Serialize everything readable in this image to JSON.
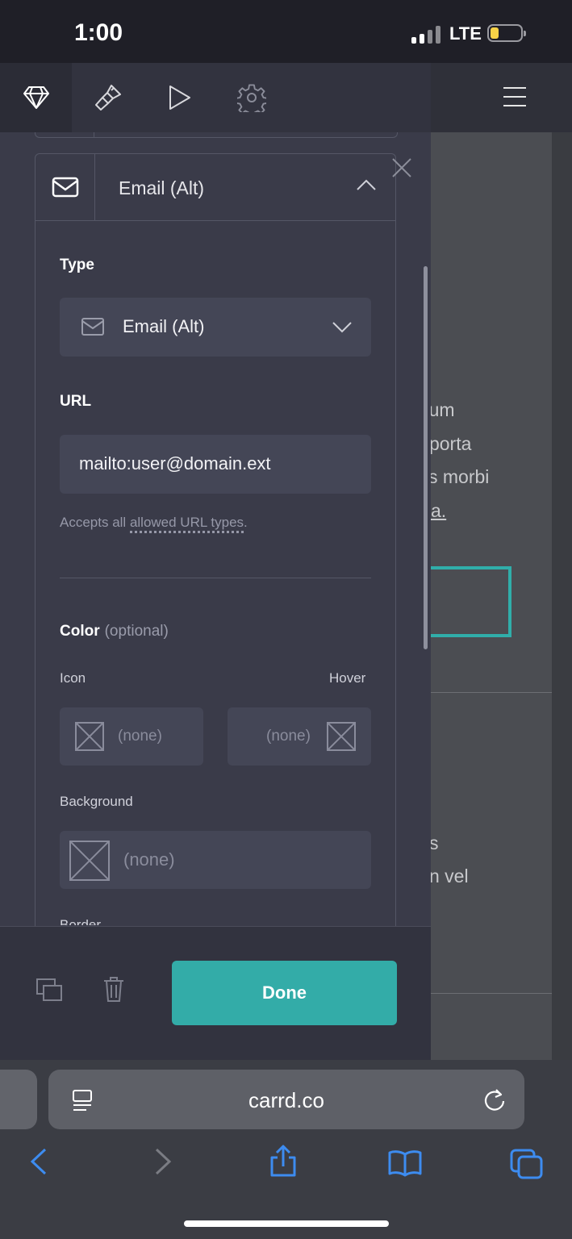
{
  "status_bar": {
    "time": "1:00",
    "network": "LTE"
  },
  "background_site": {
    "lines": [
      "terdum",
      "eu porta",
      "s morbi",
      "a.",
      "s",
      "n vel"
    ]
  },
  "toolbar": {
    "icons": [
      "diamond-icon",
      "brush-icon",
      "play-icon",
      "gear-icon"
    ],
    "menu_icon": "hamburger-icon"
  },
  "link_card": {
    "title": "Email (Alt)",
    "type": {
      "label": "Type",
      "value": "Email (Alt)"
    },
    "url": {
      "label": "URL",
      "value": "mailto:user@domain.ext",
      "hint_prefix": "Accepts all ",
      "hint_link": "allowed URL types",
      "hint_suffix": "."
    },
    "color": {
      "label": "Color",
      "optional": "(optional)",
      "icon_label": "Icon",
      "hover_label": "Hover",
      "icon_value": "(none)",
      "hover_value": "(none)",
      "background_label": "Background",
      "background_value": "(none)",
      "border_label": "Border"
    }
  },
  "footer": {
    "done_label": "Done"
  },
  "browser": {
    "url": "carrd.co"
  },
  "colors": {
    "accent": "#33aca8",
    "panel": "#3a3b49",
    "field": "#444656",
    "browser_link": "#3d8cf0"
  }
}
